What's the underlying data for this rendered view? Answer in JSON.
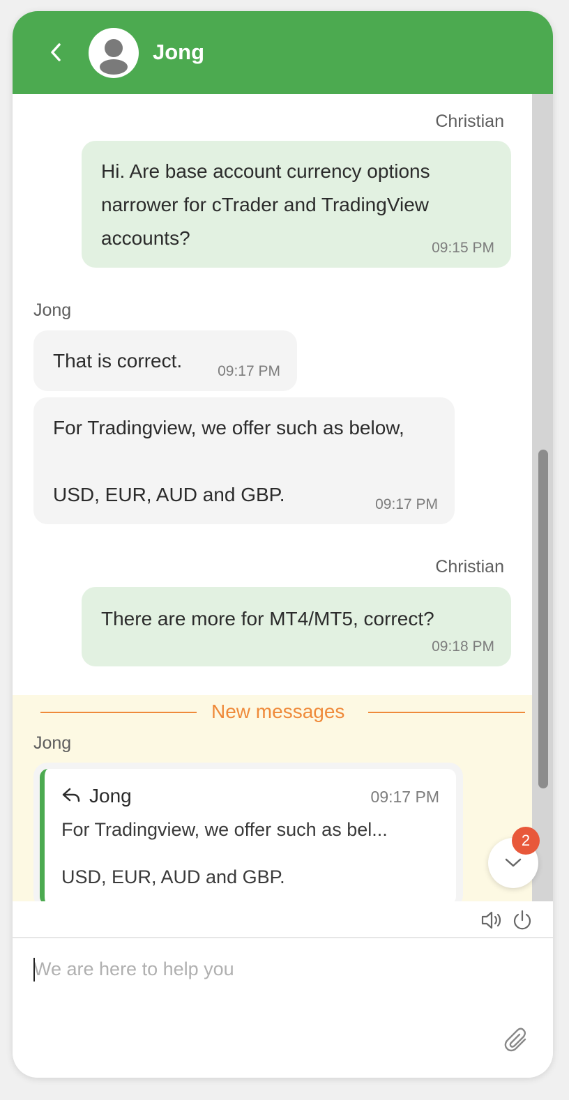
{
  "header": {
    "contact_name": "Jong"
  },
  "messages": [
    {
      "sender": "Christian",
      "direction": "out",
      "text": "Hi. Are base account currency options\nnarrower for cTrader and TradingView\naccounts?",
      "time": "09:15 PM"
    },
    {
      "sender": "Jong",
      "direction": "in",
      "text": "That is correct.",
      "time": "09:17 PM"
    },
    {
      "sender": "",
      "direction": "in",
      "text": "For Tradingview, we offer such as below,\n\nUSD, EUR, AUD and GBP.",
      "time": "09:17 PM"
    },
    {
      "sender": "Christian",
      "direction": "out",
      "text": "There are more for MT4/MT5, correct?",
      "time": "09:18 PM"
    }
  ],
  "new_messages": {
    "label": "New messages",
    "sender": "Jong",
    "reply": {
      "name": "Jong",
      "time": "09:17 PM",
      "line1": "For Tradingview, we offer such as bel...",
      "line2": "USD, EUR, AUD and GBP."
    }
  },
  "unread_badge": "2",
  "composer": {
    "placeholder": "We are here to help you"
  },
  "icons": {
    "back": "chevron-left-icon",
    "avatar": "user-avatar-icon",
    "reply": "reply-arrow-icon",
    "scroll_down": "chevron-down-icon",
    "sound": "speaker-icon",
    "power": "power-icon",
    "attach": "paperclip-icon"
  },
  "colors": {
    "brand_green": "#4caa50",
    "outgoing_bubble": "#e2f1e1",
    "incoming_bubble": "#f4f4f4",
    "new_messages_accent": "#ef8a3a",
    "new_messages_bg": "#fdf9e3",
    "badge": "#e8583a"
  }
}
